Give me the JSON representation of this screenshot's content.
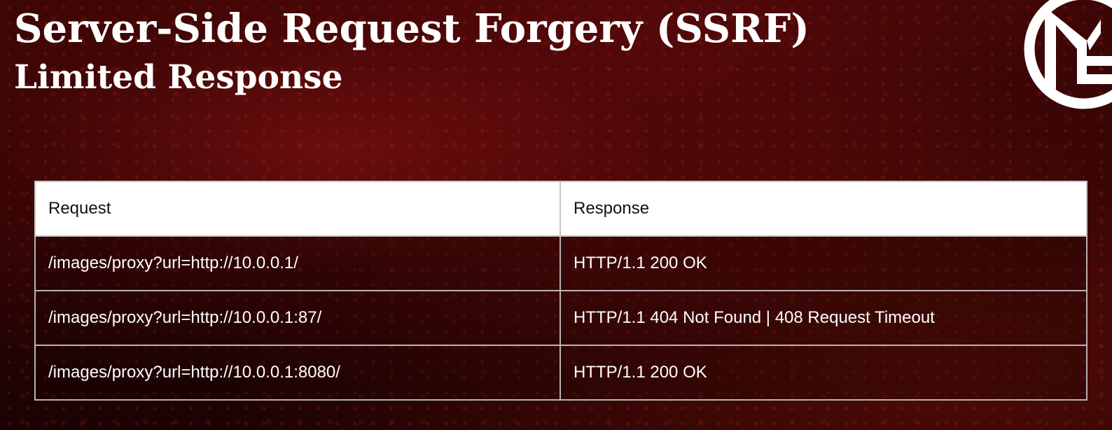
{
  "slide": {
    "title": "Server-Side Request Forgery (SSRF)",
    "subtitle": "Limited Response"
  },
  "logo": {
    "icon": "brand-monogram-logo",
    "color": "#ffffff"
  },
  "table": {
    "headers": [
      "Request",
      "Response"
    ],
    "rows": [
      [
        "/images/proxy?url=http://10.0.0.1/",
        "HTTP/1.1 200 OK"
      ],
      [
        "/images/proxy?url=http://10.0.0.1:87/",
        "HTTP/1.1 404 Not Found | 408 Request Timeout"
      ],
      [
        "/images/proxy?url=http://10.0.0.1:8080/",
        "HTTP/1.1 200 OK"
      ]
    ]
  },
  "colors": {
    "background": "#2a0404",
    "text": "#ffffff",
    "header_bg": "#ffffff",
    "border": "#b9b3b3"
  }
}
